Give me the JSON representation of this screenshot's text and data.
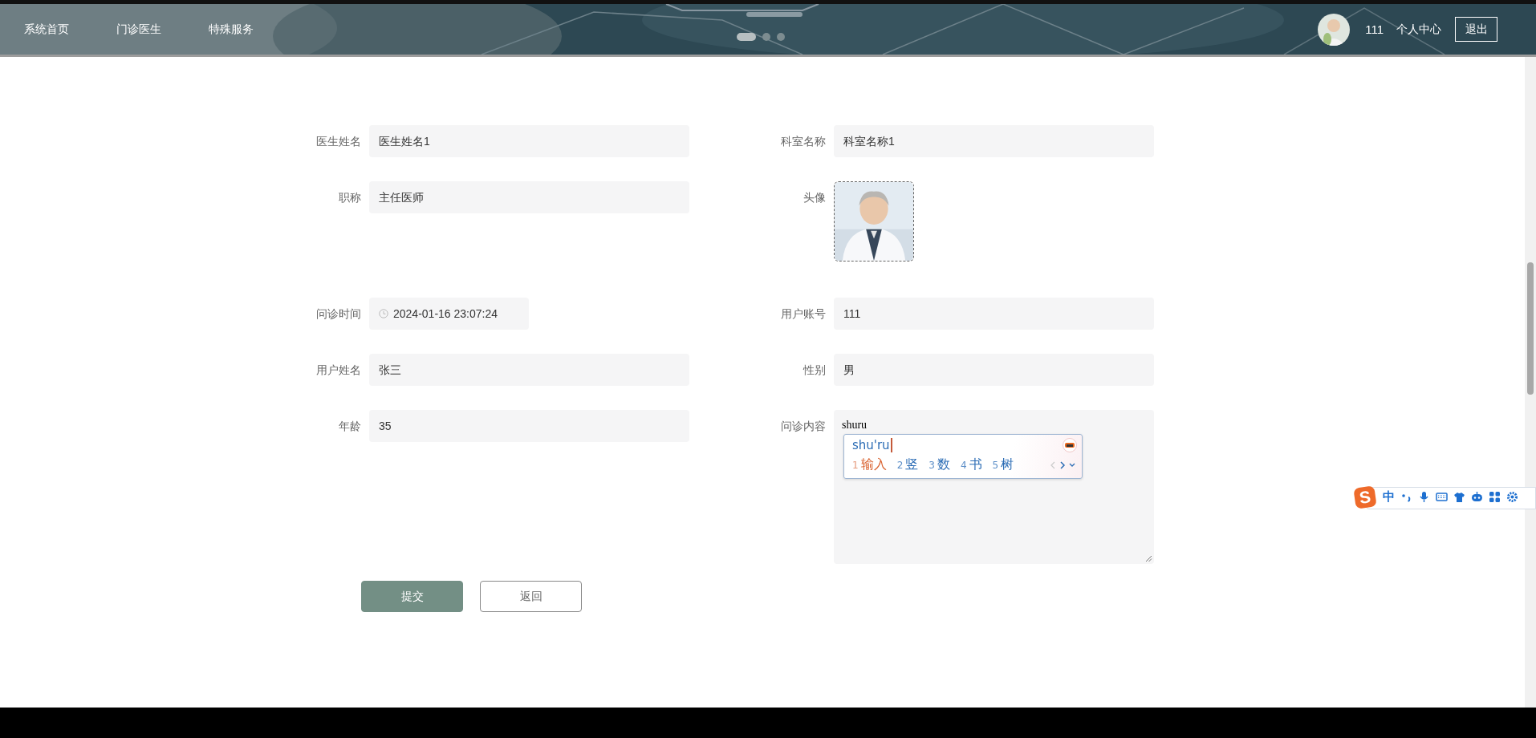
{
  "header": {
    "nav": [
      {
        "label": "系统首页"
      },
      {
        "label": "门诊医生"
      },
      {
        "label": "特殊服务"
      }
    ],
    "carousel": [
      {
        "selected": true
      },
      {
        "selected": false
      },
      {
        "selected": false
      }
    ],
    "user_name": "111",
    "profile_link": "个人中心",
    "logout": "退出"
  },
  "form": {
    "fields": [
      {
        "label": "医生姓名",
        "kind": "text",
        "value": "医生姓名1"
      },
      {
        "label": "科室名称",
        "kind": "text",
        "value": "科室名称1"
      },
      {
        "label": "职称",
        "kind": "text",
        "value": "主任医师"
      },
      {
        "label": "头像"
      },
      {
        "label": "问诊时间",
        "kind": "datetime",
        "value": "2024-01-16 23:07:24"
      },
      {
        "label": "用户账号",
        "kind": "text",
        "value": "111"
      },
      {
        "label": "用户姓名",
        "kind": "text",
        "value": "张三"
      },
      {
        "label": "性别",
        "kind": "text",
        "value": "男"
      },
      {
        "label": "年龄",
        "kind": "text",
        "value": "35"
      },
      {
        "label": "问诊内容",
        "kind": "textarea",
        "value": "shuru"
      }
    ],
    "buttons": [
      {
        "label": "提交",
        "kind": "primary"
      },
      {
        "label": "返回",
        "kind": "secondary"
      }
    ]
  },
  "ime": {
    "composition": "shu'ru",
    "candidates": [
      {
        "index": "1",
        "text": "输入",
        "selected": true
      },
      {
        "index": "2",
        "text": "竖",
        "selected": false
      },
      {
        "index": "3",
        "text": "数",
        "selected": false
      },
      {
        "index": "4",
        "text": "书",
        "selected": false
      },
      {
        "index": "5",
        "text": "树",
        "selected": false
      }
    ]
  },
  "ime_toolbar": {
    "logo": "S",
    "mode": "中"
  }
}
